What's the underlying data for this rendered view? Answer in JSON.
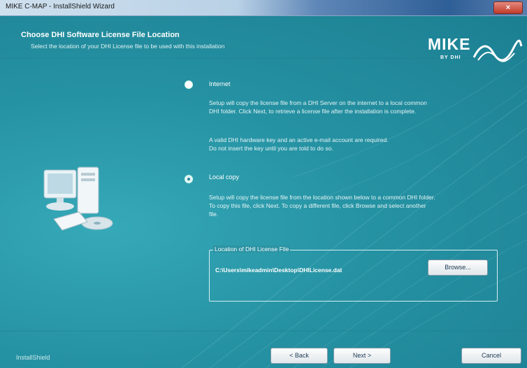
{
  "window": {
    "title": "MIKE C-MAP - InstallShield Wizard",
    "close_glyph": "×"
  },
  "header": {
    "title": "Choose DHI Software License File Location",
    "subtitle": "Select the location of your DHI License file to be used with this installation"
  },
  "logo": {
    "main": "MIKE",
    "sub": "BY DHI"
  },
  "options": [
    {
      "label": "Internet",
      "selected": true,
      "description_lines": [
        "Setup will copy the license file from a DHI Server on the internet to a local common",
        "DHI folder. Click Next, to retrieve a license file after the installation is complete."
      ],
      "note_lines": [
        "A valid DHI hardware key and an active e-mail account are required.",
        "Do not insert the key until you are told to do so."
      ]
    },
    {
      "label": "Local copy",
      "selected": false,
      "description_lines": [
        "Setup will copy the license file from the location shown below to a common DHI folder.",
        "To copy this file, click Next. To copy a different file, click Browse and select another",
        "file."
      ]
    }
  ],
  "license_group": {
    "legend": "Location of DHI License File",
    "path": "C:\\Users\\mikeadmin\\Desktop\\DHILicense.dat",
    "browse_label": "Browse..."
  },
  "footer": {
    "brand": "InstallShield",
    "back_label": "< Back",
    "next_label": "Next >",
    "cancel_label": "Cancel"
  },
  "colors": {
    "background": "#2894a4",
    "titlebar_accent": "#2f5f97",
    "text": "#ffffff"
  },
  "icons": {
    "computer": "computer-install-icon",
    "logo_wave": "mike-wave-icon"
  }
}
